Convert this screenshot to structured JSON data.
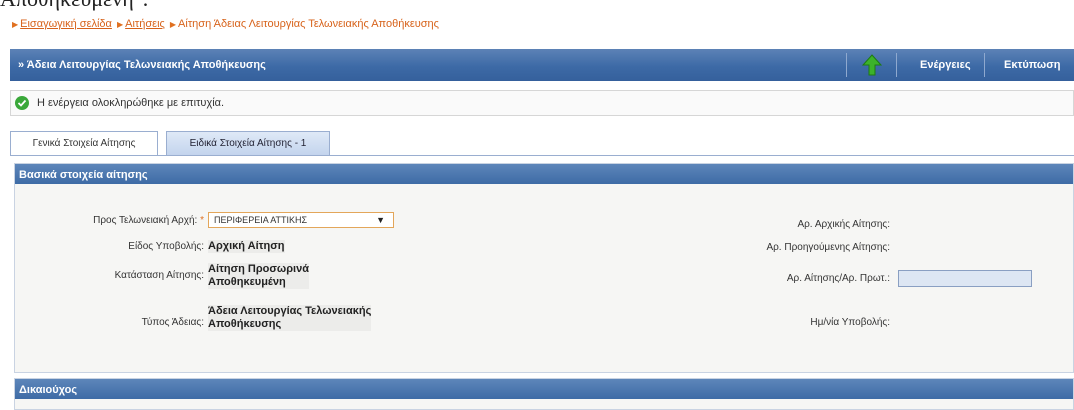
{
  "clipped_title": "Αποθηκευμένη\".",
  "breadcrumb": {
    "items": [
      {
        "label": "Εισαγωγική σελίδα"
      },
      {
        "label": "Αιτήσεις"
      }
    ],
    "current": "Αίτηση Άδειας Λειτουργίας Τελωνειακής Αποθήκευσης"
  },
  "header": {
    "title": "» Άδεια Λειτουργίας Τελωνειακής Αποθήκευσης",
    "actions_label": "Ενέργειες",
    "print_label": "Εκτύπωση",
    "up_icon": "green-up-arrow"
  },
  "status": {
    "message": "Η ενέργεια ολοκληρώθηκε με επιτυχία.",
    "color": "#3aa83a"
  },
  "tabs": [
    {
      "label": "Γενικά Στοιχεία Αίτησης",
      "active": true
    },
    {
      "label": "Ειδικά Στοιχεία Αίτησης - 1",
      "active": false
    }
  ],
  "section_basic": {
    "title": "Βασικά στοιχεία αίτησης",
    "customs_office": {
      "label": "Προς Τελωνειακή Αρχή:",
      "required_mark": "*",
      "value": "ΠΕΡΙΦΕΡΕΙΑ ΑΤΤΙΚΗΣ"
    },
    "submission_type": {
      "label": "Είδος Υποβολής:",
      "value": "Αρχική Αίτηση"
    },
    "status": {
      "label": "Κατάσταση Αίτησης:",
      "value_line1": "Αίτηση Προσωρινά",
      "value_line2": "Αποθηκευμένη"
    },
    "license_type": {
      "label": "Τύπος Άδειας:",
      "value_line1": "Άδεια Λειτουργίας Τελωνειακής",
      "value_line2": "Αποθήκευσης"
    },
    "initial_app_no": {
      "label": "Αρ. Αρχικής Αίτησης:",
      "value": ""
    },
    "previous_app_no": {
      "label": "Αρ. Προηγούμενης Αίτησης:",
      "value": ""
    },
    "app_protocol_no": {
      "label": "Αρ. Αίτησης/Αρ. Πρωτ.:",
      "value": ""
    },
    "submission_date": {
      "label": "Ημ/νία Υποβολής:",
      "value": ""
    }
  },
  "section_beneficiary": {
    "title": "Δικαιούχος"
  },
  "colors": {
    "header_blue": "#3d6aa6",
    "link_orange": "#d7621a"
  }
}
